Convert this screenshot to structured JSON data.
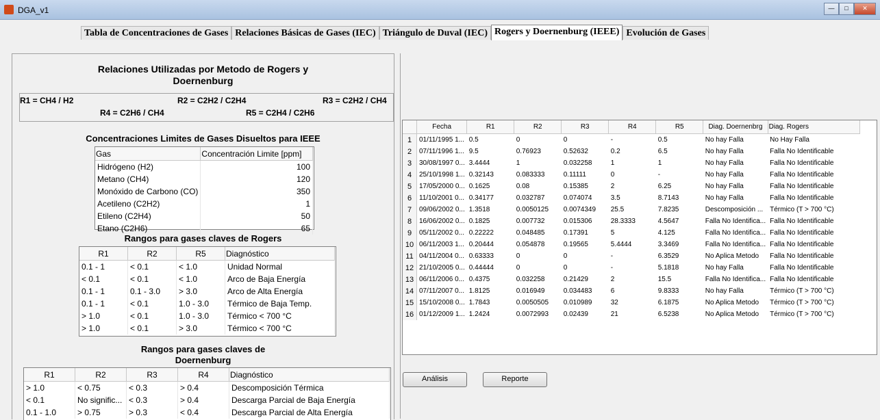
{
  "window": {
    "title": "DGA_v1"
  },
  "tabs": [
    "Tabla de Concentraciones de Gases",
    "Relaciones Básicas de Gases (IEC)",
    "Triángulo de Duval (IEC)",
    "Rogers y Doernenburg (IEEE)",
    "Evolución de Gases"
  ],
  "left": {
    "title1": "Relaciones Utilizadas por Metodo de Rogers y",
    "title2": "Doernenburg",
    "r1": "R1 = CH4 / H2",
    "r2": "R2 = C2H2 / C2H4",
    "r3": "R3 = C2H2 / CH4",
    "r4": "R4 = C2H6 / CH4",
    "r5": "R5 = C2H4 / C2H6",
    "limits_title": "Concentraciones Limites de Gases Disueltos para IEEE",
    "limits_headers": [
      "Gas",
      "Concentración Limite [ppm]"
    ],
    "limits_rows": [
      [
        "Hidrógeno (H2)",
        "100"
      ],
      [
        "Metano (CH4)",
        "120"
      ],
      [
        "Monóxido de Carbono (CO)",
        "350"
      ],
      [
        "Acetileno (C2H2)",
        "1"
      ],
      [
        "Etileno (C2H4)",
        "50"
      ],
      [
        "Etano (C2H6)",
        "65"
      ]
    ],
    "rogers_title": "Rangos para gases claves de Rogers",
    "rogers_headers": [
      "R1",
      "R2",
      "R5",
      "Diagnóstico"
    ],
    "rogers_rows": [
      [
        "0.1 - 1",
        "< 0.1",
        "< 1.0",
        "Unidad Normal"
      ],
      [
        "< 0.1",
        "< 0.1",
        "< 1.0",
        "Arco de Baja Energía"
      ],
      [
        "0.1 - 1",
        "0.1 - 3.0",
        "> 3.0",
        "Arco de Alta Energía"
      ],
      [
        "0.1 - 1",
        "< 0.1",
        "1.0 - 3.0",
        "Térmico de Baja Temp."
      ],
      [
        "> 1.0",
        "< 0.1",
        "1.0 - 3.0",
        "Térmico < 700 °C"
      ],
      [
        "> 1.0",
        "< 0.1",
        "> 3.0",
        "Térmico < 700 °C"
      ]
    ],
    "doern_title1": "Rangos para gases claves de",
    "doern_title2": "Doernenburg",
    "doern_headers": [
      "R1",
      "R2",
      "R3",
      "R4",
      "Diagnóstico"
    ],
    "doern_rows": [
      [
        "> 1.0",
        "< 0.75",
        "< 0.3",
        "> 0.4",
        "Descomposición Térmica"
      ],
      [
        "< 0.1",
        "No signific...",
        "< 0.3",
        "> 0.4",
        "Descarga Parcial de Baja Energía"
      ],
      [
        "0.1 - 1.0",
        "> 0.75",
        "> 0.3",
        "< 0.4",
        "Descarga Parcial de Alta Energía"
      ]
    ]
  },
  "results": {
    "headers": [
      "Fecha",
      "R1",
      "R2",
      "R3",
      "R4",
      "R5",
      "Diag. Doernenbrg",
      "Diag. Rogers"
    ],
    "rows": [
      [
        "1",
        "01/11/1995 1...",
        "0.5",
        "0",
        "0",
        "-",
        "0.5",
        "No hay Falla",
        "No Hay Falla"
      ],
      [
        "2",
        "07/11/1996 1...",
        "9.5",
        "0.76923",
        "0.52632",
        "0.2",
        "6.5",
        "No hay Falla",
        "Falla No Identificable"
      ],
      [
        "3",
        "30/08/1997 0...",
        "3.4444",
        "1",
        "0.032258",
        "1",
        "1",
        "No hay Falla",
        "Falla No Identificable"
      ],
      [
        "4",
        "25/10/1998 1...",
        "0.32143",
        "0.083333",
        "0.11111",
        "0",
        "-",
        "No hay Falla",
        "Falla No Identificable"
      ],
      [
        "5",
        "17/05/2000 0...",
        "0.1625",
        "0.08",
        "0.15385",
        "2",
        "6.25",
        "No hay Falla",
        "Falla No Identificable"
      ],
      [
        "6",
        "11/10/2001 0...",
        "0.34177",
        "0.032787",
        "0.074074",
        "3.5",
        "8.7143",
        "No hay Falla",
        "Falla No Identificable"
      ],
      [
        "7",
        "09/06/2002 0...",
        "1.3518",
        "0.0050125",
        "0.0074349",
        "25.5",
        "7.8235",
        "Descomposición ...",
        "Térmico (T > 700 °C)"
      ],
      [
        "8",
        "16/06/2002 0...",
        "0.1825",
        "0.007732",
        "0.015306",
        "28.3333",
        "4.5647",
        "Falla No Identifica...",
        "Falla No Identificable"
      ],
      [
        "9",
        "05/11/2002 0...",
        "0.22222",
        "0.048485",
        "0.17391",
        "5",
        "4.125",
        "Falla No Identifica...",
        "Falla No Identificable"
      ],
      [
        "10",
        "06/11/2003 1...",
        "0.20444",
        "0.054878",
        "0.19565",
        "5.4444",
        "3.3469",
        "Falla No Identifica...",
        "Falla No Identificable"
      ],
      [
        "11",
        "04/11/2004 0...",
        "0.63333",
        "0",
        "0",
        "-",
        "6.3529",
        "No Aplica Metodo",
        "Falla No Identificable"
      ],
      [
        "12",
        "21/10/2005 0...",
        "0.44444",
        "0",
        "0",
        "-",
        "5.1818",
        "No hay Falla",
        "Falla No Identificable"
      ],
      [
        "13",
        "06/11/2006 0...",
        "0.4375",
        "0.032258",
        "0.21429",
        "2",
        "15.5",
        "Falla No Identifica...",
        "Falla No Identificable"
      ],
      [
        "14",
        "07/11/2007 0...",
        "1.8125",
        "0.016949",
        "0.034483",
        "6",
        "9.8333",
        "No hay Falla",
        "Térmico (T > 700 °C)"
      ],
      [
        "15",
        "15/10/2008 0...",
        "1.7843",
        "0.0050505",
        "0.010989",
        "32",
        "6.1875",
        "No Aplica Metodo",
        "Térmico (T > 700 °C)"
      ],
      [
        "16",
        "01/12/2009 1...",
        "1.2424",
        "0.0072993",
        "0.02439",
        "21",
        "6.5238",
        "No Aplica Metodo",
        "Térmico (T > 700 °C)"
      ]
    ]
  },
  "buttons": {
    "analisis": "Análisis",
    "reporte": "Reporte"
  }
}
